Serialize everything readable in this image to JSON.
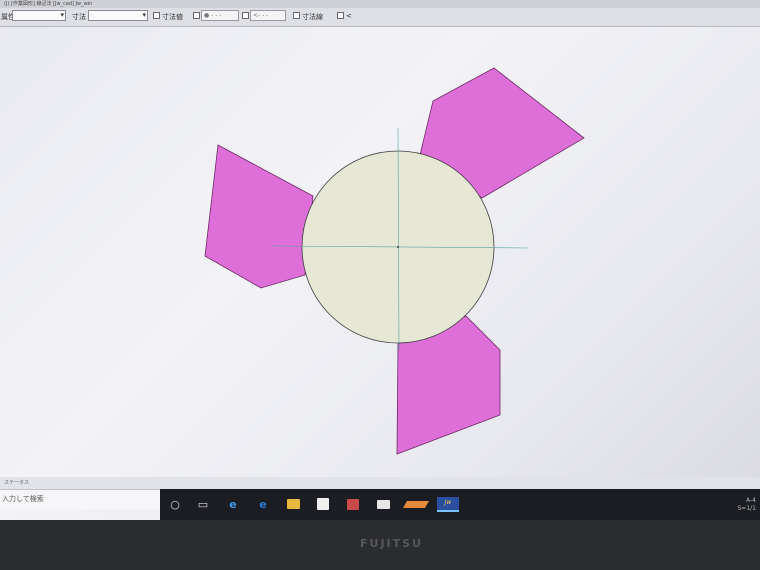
{
  "titlebar": {
    "text": "(J) [作業図形] 線記法 [Jw_cad] Jw_win"
  },
  "toolbar": {
    "label_layer": "属性",
    "label_dim": "寸法",
    "check_dim_value": "寸法値",
    "check_line": "寸法線",
    "check_angle": "<"
  },
  "statusbar": {
    "text": "ステータス"
  },
  "search": {
    "placeholder": "入力して検索"
  },
  "tray": {
    "scale": "A-4",
    "ratio": "S=1/1"
  },
  "bezel": {
    "brand": "FUJITSU"
  },
  "drawing": {
    "circle_fill": "#e6e7d4",
    "blade_fill": "#de6fd8",
    "centerline_color": "#5aa2a0"
  }
}
